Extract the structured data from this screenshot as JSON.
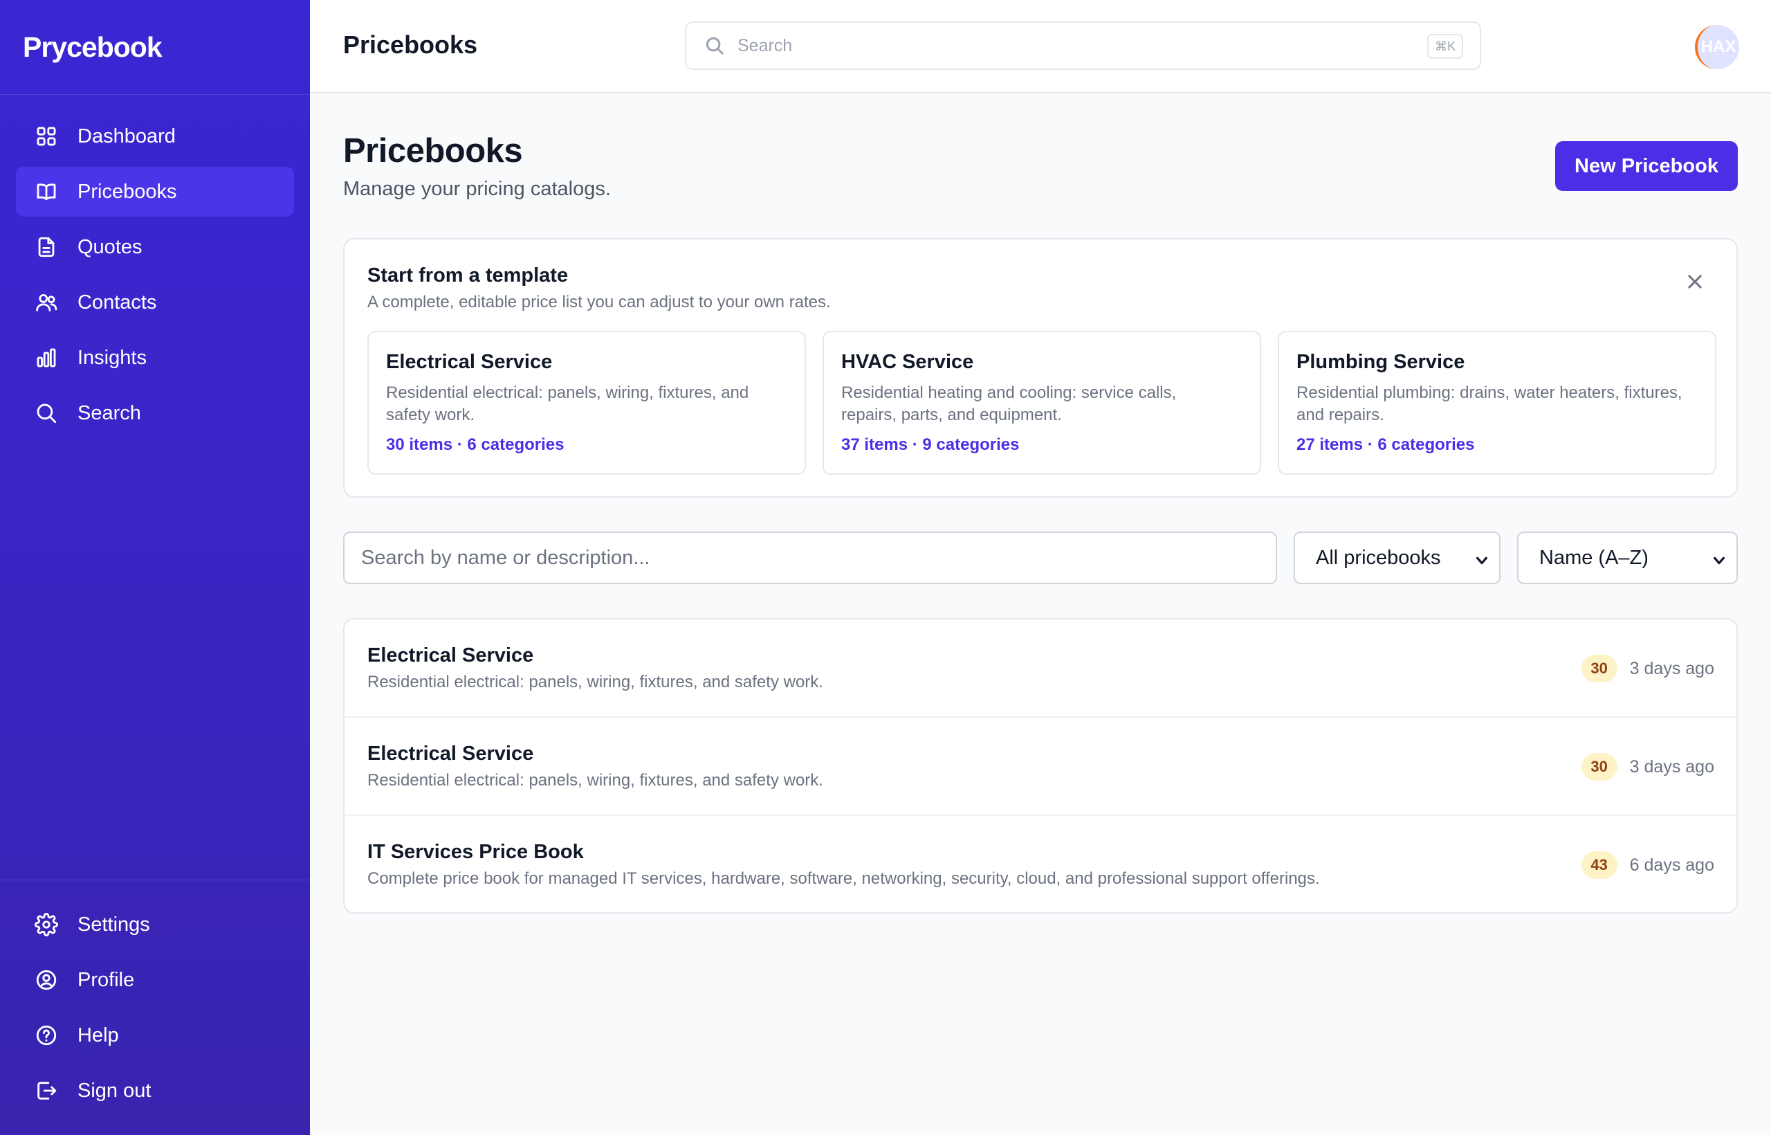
{
  "sidebar": {
    "brand": "Prycebook",
    "items": [
      {
        "label": "Dashboard",
        "icon": "grid-icon"
      },
      {
        "label": "Pricebooks",
        "icon": "book-icon",
        "active": true
      },
      {
        "label": "Quotes",
        "icon": "document-icon"
      },
      {
        "label": "Contacts",
        "icon": "users-icon"
      },
      {
        "label": "Insights",
        "icon": "bar-chart-icon"
      },
      {
        "label": "Search",
        "icon": "search-icon"
      }
    ],
    "bottom_items": [
      {
        "label": "Settings",
        "icon": "gear-icon"
      },
      {
        "label": "Profile",
        "icon": "user-circle-icon"
      },
      {
        "label": "Help",
        "icon": "help-circle-icon"
      },
      {
        "label": "Sign out",
        "icon": "sign-out-icon"
      }
    ]
  },
  "topbar": {
    "title": "Pricebooks",
    "search_placeholder": "Search",
    "shortcut": "⌘K",
    "avatar_text": "HAX"
  },
  "page": {
    "title": "Pricebooks",
    "subtitle": "Manage your pricing catalogs.",
    "new_button": "New Pricebook"
  },
  "templates": {
    "title": "Start from a template",
    "subtitle": "A complete, editable price list you can adjust to your own rates.",
    "cards": [
      {
        "name": "Electrical Service",
        "description": "Residential electrical: panels, wiring, fixtures, and safety work.",
        "meta": "30 items · 6 categories"
      },
      {
        "name": "HVAC Service",
        "description": "Residential heating and cooling: service calls, repairs, parts, and equipment.",
        "meta": "37 items · 9 categories"
      },
      {
        "name": "Plumbing Service",
        "description": "Residential plumbing: drains, water heaters, fixtures, and repairs.",
        "meta": "27 items · 6 categories"
      }
    ]
  },
  "filters": {
    "search_placeholder": "Search by name or description...",
    "search_value": "",
    "scope_selected": "All pricebooks",
    "sort_selected": "Name (A–Z)"
  },
  "pricebooks": [
    {
      "name": "Electrical Service",
      "description": "Residential electrical: panels, wiring, fixtures, and safety work.",
      "count": "30",
      "updated": "3 days ago"
    },
    {
      "name": "Electrical Service",
      "description": "Residential electrical: panels, wiring, fixtures, and safety work.",
      "count": "30",
      "updated": "3 days ago"
    },
    {
      "name": "IT Services Price Book",
      "description": "Complete price book for managed IT services, hardware, software, networking, security, cloud, and professional support offerings.",
      "count": "43",
      "updated": "6 days ago"
    }
  ],
  "colors": {
    "sidebar": "#3a27d3",
    "accent": "#4a2fe6",
    "badge_bg": "#fdf3c7",
    "badge_text": "#92400e"
  }
}
